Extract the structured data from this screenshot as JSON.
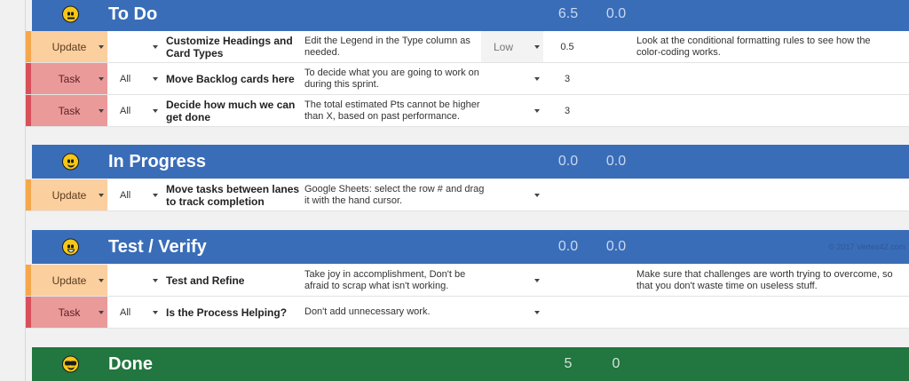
{
  "lanes": [
    {
      "id": "todo",
      "title": "To Do",
      "icon": "neutral-face-icon",
      "est_total": "6.5",
      "act_total": "0.0",
      "color": "#3a6db8",
      "rows": [
        {
          "type": "Update",
          "sprint": "",
          "title": "Customize Headings and Card Types",
          "description": "Edit the Legend in the Type column as needed.",
          "priority": "Low",
          "pts": "0.5",
          "notes": "Look at the conditional formatting rules to see how the color-coding works."
        },
        {
          "type": "Task",
          "sprint": "All",
          "title": "Move Backlog cards here",
          "description": "To decide what you are going to work on during this sprint.",
          "priority": "",
          "pts": "3",
          "notes": ""
        },
        {
          "type": "Task",
          "sprint": "All",
          "title": "Decide how much we can get done",
          "description": "The total estimated Pts cannot be higher than X, based on past performance.",
          "priority": "",
          "pts": "3",
          "notes": ""
        }
      ]
    },
    {
      "id": "inprogress",
      "title": "In Progress",
      "icon": "smiling-face-icon",
      "est_total": "0.0",
      "act_total": "0.0",
      "color": "#3a6db8",
      "rows": [
        {
          "type": "Update",
          "sprint": "All",
          "title": "Move tasks between lanes to track completion",
          "description": "Google Sheets: select the row # and drag it with the hand cursor.",
          "priority": "",
          "pts": "",
          "notes": ""
        }
      ]
    },
    {
      "id": "test",
      "title": "Test / Verify",
      "icon": "grinning-face-icon",
      "est_total": "0.0",
      "act_total": "0.0",
      "color": "#3a6db8",
      "copyright": "© 2017 Vertex42.com",
      "rows": [
        {
          "type": "Update",
          "sprint": "",
          "title": "Test and Refine",
          "description": "Take joy in accomplishment, Don't be afraid to scrap what isn't working.",
          "priority": "",
          "pts": "",
          "notes": "Make sure that challenges are worth trying to overcome, so that you don't waste time on useless stuff."
        },
        {
          "type": "Task",
          "sprint": "All",
          "title": "Is the Process Helping?",
          "description": "Don't add unnecessary work.",
          "priority": "",
          "pts": "",
          "notes": ""
        }
      ]
    },
    {
      "id": "done",
      "title": "Done",
      "icon": "sunglasses-face-icon",
      "est_total": "5",
      "act_total": "0",
      "color": "#22763f",
      "rows": []
    }
  ]
}
